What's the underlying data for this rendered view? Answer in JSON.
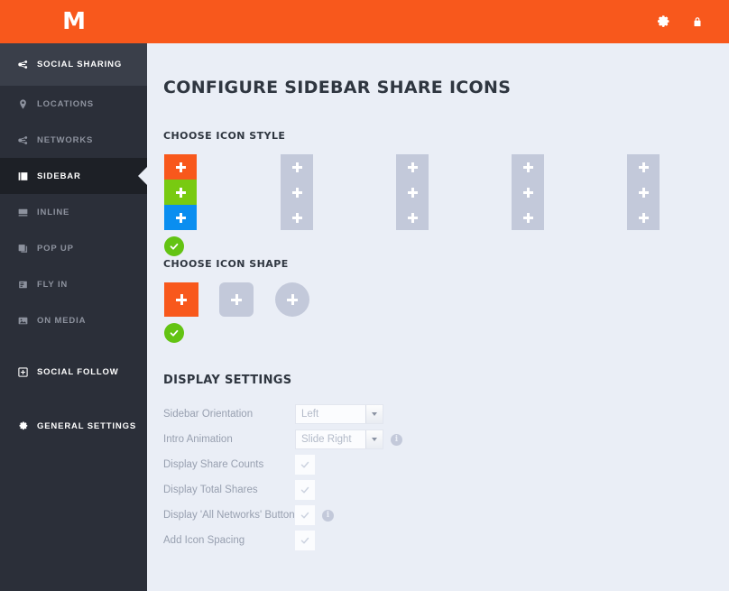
{
  "brand": {
    "logo_text": "M",
    "accent": "#f8581c",
    "green": "#63c313",
    "blue": "#0a8ef0"
  },
  "topbar": {
    "settings_icon": "gear-icon",
    "lock_icon": "lock-icon"
  },
  "sidebar": {
    "items": [
      {
        "label": "SOCIAL SHARING",
        "icon": "share-nodes-icon",
        "type": "header",
        "selected": false
      },
      {
        "label": "LOCATIONS",
        "icon": "map-pin-icon",
        "type": "sub",
        "selected": false
      },
      {
        "label": "NETWORKS",
        "icon": "share-nodes-icon",
        "type": "sub",
        "selected": false
      },
      {
        "label": "SIDEBAR",
        "icon": "sidebar-icon",
        "type": "sub",
        "selected": true
      },
      {
        "label": "INLINE",
        "icon": "inline-icon",
        "type": "sub",
        "selected": false
      },
      {
        "label": "POP UP",
        "icon": "popup-icon",
        "type": "sub",
        "selected": false
      },
      {
        "label": "FLY IN",
        "icon": "flyin-icon",
        "type": "sub",
        "selected": false
      },
      {
        "label": "ON MEDIA",
        "icon": "image-icon",
        "type": "sub",
        "selected": false
      },
      {
        "label": "SOCIAL FOLLOW",
        "icon": "plus-box-icon",
        "type": "plain",
        "selected": false
      },
      {
        "label": "GENERAL SETTINGS",
        "icon": "gear-icon",
        "type": "plain",
        "selected": false
      }
    ]
  },
  "main": {
    "page_title": "CONFIGURE SIDEBAR SHARE ICONS",
    "icon_style": {
      "heading": "CHOOSE ICON STYLE",
      "options": [
        {
          "name": "style-colored",
          "selected": true,
          "tile_colors": [
            "#f8581c",
            "#78ca11",
            "#0a8ef0"
          ]
        },
        {
          "name": "style-option-2",
          "selected": false,
          "tile_colors": [
            "#c3c9da",
            "#c3c9da",
            "#c3c9da"
          ]
        },
        {
          "name": "style-option-3",
          "selected": false,
          "tile_colors": [
            "#c3c9da",
            "#c3c9da",
            "#c3c9da"
          ]
        },
        {
          "name": "style-option-4",
          "selected": false,
          "tile_colors": [
            "#c3c9da",
            "#c3c9da",
            "#c3c9da"
          ]
        },
        {
          "name": "style-option-5",
          "selected": false,
          "tile_colors": [
            "#c3c9da",
            "#c3c9da",
            "#c3c9da"
          ]
        }
      ]
    },
    "icon_shape": {
      "heading": "CHOOSE ICON SHAPE",
      "options": [
        {
          "name": "shape-square",
          "shape": "square",
          "selected": true
        },
        {
          "name": "shape-rounded",
          "shape": "rounded",
          "selected": false
        },
        {
          "name": "shape-circle",
          "shape": "circle",
          "selected": false
        }
      ]
    },
    "display_settings": {
      "heading": "DISPLAY SETTINGS",
      "rows": [
        {
          "label": "Sidebar Orientation",
          "control": "select",
          "value": "Left",
          "info": false
        },
        {
          "label": "Intro Animation",
          "control": "select",
          "value": "Slide Right",
          "info": true
        },
        {
          "label": "Display Share Counts",
          "control": "checkbox",
          "checked": true,
          "info": false
        },
        {
          "label": "Display Total Shares",
          "control": "checkbox",
          "checked": true,
          "info": false
        },
        {
          "label": "Display 'All Networks' Button",
          "control": "checkbox",
          "checked": true,
          "info": true
        },
        {
          "label": "Add Icon Spacing",
          "control": "checkbox",
          "checked": true,
          "info": false
        }
      ],
      "info_glyph": "i"
    }
  }
}
